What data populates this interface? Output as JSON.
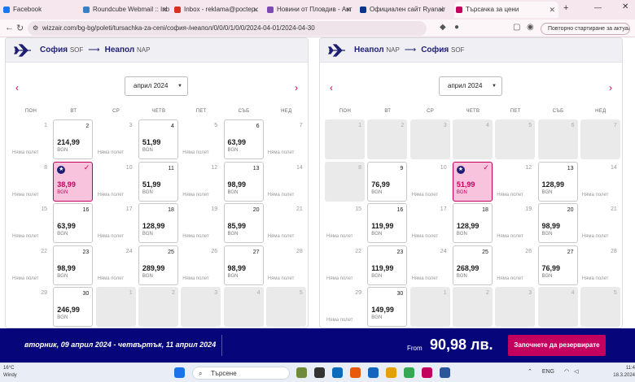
{
  "browser": {
    "tabs": [
      {
        "title": "Facebook",
        "color": "#1877f2"
      },
      {
        "title": "Roundcube Webmail :: Inb",
        "color": "#3a7fc1"
      },
      {
        "title": "Inbox - reklama@poctep.",
        "color": "#d93025"
      },
      {
        "title": "Новини от Пловдив - Акт",
        "color": "#7b4bb3"
      },
      {
        "title": "Официален сайт Ryanair",
        "color": "#073590"
      },
      {
        "title": "Търсачка за цени",
        "color": "#c4005e"
      }
    ],
    "new_tab": "+",
    "url": "wizzair.com/bg-bg/poleti/tursachka-za-ceni/софия-/неапол/0/0/0/1/0/0/2024-04-01/2024-04-30",
    "update_button": "Повторно стартиране за актуализира"
  },
  "panels": [
    {
      "from_city": "София",
      "from_code": "SOF",
      "to_city": "Неапол",
      "to_code": "NAP",
      "month": "април 2024",
      "weekdays": [
        "ПОН",
        "ВТ",
        "СР",
        "ЧЕТВ",
        "ПЕТ",
        "СЪБ",
        "НЕД"
      ],
      "days": [
        {
          "d": "1",
          "s": "none",
          "label": "Няма полет"
        },
        {
          "d": "2",
          "s": "avail",
          "price": "214,99",
          "cur": "BGN"
        },
        {
          "d": "3",
          "s": "none",
          "label": "Няма полет"
        },
        {
          "d": "4",
          "s": "avail",
          "price": "51,99",
          "cur": "BGN"
        },
        {
          "d": "5",
          "s": "none",
          "label": "Няма полет"
        },
        {
          "d": "6",
          "s": "avail",
          "price": "63,99",
          "cur": "BGN"
        },
        {
          "d": "7",
          "s": "none",
          "label": "Няма полет"
        },
        {
          "d": "8",
          "s": "none",
          "label": "Няма полет"
        },
        {
          "d": "9",
          "s": "sel",
          "price": "38,99",
          "cur": "BGN"
        },
        {
          "d": "10",
          "s": "none",
          "label": "Няма полет"
        },
        {
          "d": "11",
          "s": "avail",
          "price": "51,99",
          "cur": "BGN"
        },
        {
          "d": "12",
          "s": "none",
          "label": "Няма полет"
        },
        {
          "d": "13",
          "s": "avail",
          "price": "98,99",
          "cur": "BGN"
        },
        {
          "d": "14",
          "s": "none",
          "label": "Няма полет"
        },
        {
          "d": "15",
          "s": "none",
          "label": "Няма полет"
        },
        {
          "d": "16",
          "s": "avail",
          "price": "63,99",
          "cur": "BGN"
        },
        {
          "d": "17",
          "s": "none",
          "label": "Няма полет"
        },
        {
          "d": "18",
          "s": "avail",
          "price": "128,99",
          "cur": "BGN"
        },
        {
          "d": "19",
          "s": "none",
          "label": "Няма полет"
        },
        {
          "d": "20",
          "s": "avail",
          "price": "85,99",
          "cur": "BGN"
        },
        {
          "d": "21",
          "s": "none",
          "label": "Няма полет"
        },
        {
          "d": "22",
          "s": "none",
          "label": "Няма полет"
        },
        {
          "d": "23",
          "s": "avail",
          "price": "98,99",
          "cur": "BGN"
        },
        {
          "d": "24",
          "s": "none",
          "label": "Няма полет"
        },
        {
          "d": "25",
          "s": "avail",
          "price": "289,99",
          "cur": "BGN"
        },
        {
          "d": "26",
          "s": "none",
          "label": "Няма полет"
        },
        {
          "d": "27",
          "s": "avail",
          "price": "98,99",
          "cur": "BGN"
        },
        {
          "d": "28",
          "s": "none",
          "label": "Няма полет"
        },
        {
          "d": "29",
          "s": "none",
          "label": ""
        },
        {
          "d": "30",
          "s": "avail",
          "price": "246,99",
          "cur": "BGN"
        },
        {
          "d": "1",
          "s": "past"
        },
        {
          "d": "2",
          "s": "past"
        },
        {
          "d": "3",
          "s": "past"
        },
        {
          "d": "4",
          "s": "past"
        },
        {
          "d": "5",
          "s": "past"
        }
      ]
    },
    {
      "from_city": "Неапол",
      "from_code": "NAP",
      "to_city": "София",
      "to_code": "SOF",
      "month": "април 2024",
      "weekdays": [
        "ПОН",
        "ВТ",
        "СР",
        "ЧЕТВ",
        "ПЕТ",
        "СЪБ",
        "НЕД"
      ],
      "days": [
        {
          "d": "1",
          "s": "past"
        },
        {
          "d": "2",
          "s": "past"
        },
        {
          "d": "3",
          "s": "past"
        },
        {
          "d": "4",
          "s": "past"
        },
        {
          "d": "5",
          "s": "past"
        },
        {
          "d": "6",
          "s": "past"
        },
        {
          "d": "7",
          "s": "past"
        },
        {
          "d": "8",
          "s": "past"
        },
        {
          "d": "9",
          "s": "avail",
          "price": "76,99",
          "cur": "BGN"
        },
        {
          "d": "10",
          "s": "none",
          "label": "Няма полет"
        },
        {
          "d": "11",
          "s": "sel",
          "price": "51,99",
          "cur": "BGN"
        },
        {
          "d": "12",
          "s": "none",
          "label": "Няма полет"
        },
        {
          "d": "13",
          "s": "avail",
          "price": "128,99",
          "cur": "BGN"
        },
        {
          "d": "14",
          "s": "none",
          "label": "Няма полет"
        },
        {
          "d": "15",
          "s": "none",
          "label": "Няма полет"
        },
        {
          "d": "16",
          "s": "avail",
          "price": "119,99",
          "cur": "BGN"
        },
        {
          "d": "17",
          "s": "none",
          "label": "Няма полет"
        },
        {
          "d": "18",
          "s": "avail",
          "price": "128,99",
          "cur": "BGN"
        },
        {
          "d": "19",
          "s": "none",
          "label": "Няма полет"
        },
        {
          "d": "20",
          "s": "avail",
          "price": "98,99",
          "cur": "BGN"
        },
        {
          "d": "21",
          "s": "none",
          "label": "Няма полет"
        },
        {
          "d": "22",
          "s": "none",
          "label": "Няма полет"
        },
        {
          "d": "23",
          "s": "avail",
          "price": "119,99",
          "cur": "BGN"
        },
        {
          "d": "24",
          "s": "none",
          "label": "Няма полет"
        },
        {
          "d": "25",
          "s": "avail",
          "price": "268,99",
          "cur": "BGN"
        },
        {
          "d": "26",
          "s": "none",
          "label": "Няма полет"
        },
        {
          "d": "27",
          "s": "avail",
          "price": "76,99",
          "cur": "BGN"
        },
        {
          "d": "28",
          "s": "none",
          "label": "Няма полет"
        },
        {
          "d": "29",
          "s": "none",
          "label": "Няма полет"
        },
        {
          "d": "30",
          "s": "avail",
          "price": "149,99",
          "cur": "BGN"
        },
        {
          "d": "1",
          "s": "past"
        },
        {
          "d": "2",
          "s": "past"
        },
        {
          "d": "3",
          "s": "past"
        },
        {
          "d": "4",
          "s": "past"
        },
        {
          "d": "5",
          "s": "past"
        }
      ]
    }
  ],
  "footer": {
    "dates": "вторник, 09 април 2024 - четвъртък, 11 април 2024",
    "from_label": "From",
    "total": "90,98 лв.",
    "cta": "Започнете да резервирате"
  },
  "taskbar": {
    "temp": "16°C",
    "condition": "Windy",
    "search": "Търсене",
    "lang": "ENG",
    "time": "11:4",
    "date": "18.3.2024"
  },
  "colors": {
    "brand_navy": "#06067a",
    "brand_pink": "#c4005e",
    "selected_bg": "#f8c3dd"
  }
}
